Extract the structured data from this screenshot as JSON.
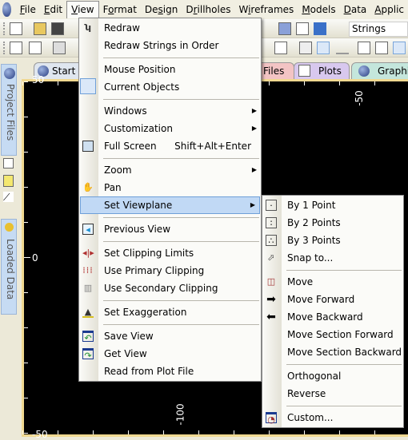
{
  "menubar": {
    "items": [
      {
        "label": "File",
        "u": "F",
        "rest": "ile"
      },
      {
        "label": "Edit",
        "u": "E",
        "rest": "dit"
      },
      {
        "label": "View",
        "u": "V",
        "rest": "iew"
      },
      {
        "label": "Format",
        "pre": "F",
        "u": "o",
        "rest": "rmat"
      },
      {
        "label": "Design",
        "pre": "De",
        "u": "s",
        "rest": "ign"
      },
      {
        "label": "Drillholes",
        "pre": "D",
        "u": "r",
        "rest": "illholes"
      },
      {
        "label": "Wireframes",
        "pre": "W",
        "u": "i",
        "rest": "reframes"
      },
      {
        "label": "Models",
        "u": "M",
        "rest": "odels"
      },
      {
        "label": "Data",
        "u": "D",
        "rest": "ata"
      },
      {
        "label": "Applic",
        "u": "A",
        "rest": "pplic"
      }
    ]
  },
  "toolbar": {
    "dropdown_value": "Strings"
  },
  "tabs": [
    {
      "label": "Start"
    },
    {
      "label": "Files",
      "color": "#f3c4c4"
    },
    {
      "label": "Plots",
      "color": "#d8c8ee"
    },
    {
      "label": "Graphics",
      "color": "#c4e6dc"
    }
  ],
  "sidebar": {
    "project_files": "Project Files",
    "loaded_data": "Loaded Data"
  },
  "viewport": {
    "top_label": "-50",
    "bottom_label": "-100",
    "left_labels": [
      "50",
      "0",
      "-50"
    ]
  },
  "view_menu": {
    "items": [
      {
        "label": "Redraw",
        "icon": "redraw-icon"
      },
      {
        "label": "Redraw Strings in Order"
      },
      {
        "sep": true
      },
      {
        "label": "Mouse Position"
      },
      {
        "label": "Current Objects",
        "icon": "current-objects-icon"
      },
      {
        "sep": true
      },
      {
        "label": "Windows",
        "submenu": true
      },
      {
        "label": "Customization",
        "submenu": true
      },
      {
        "label": "Full Screen",
        "shortcut": "Shift+Alt+Enter",
        "icon": "full-screen-icon"
      },
      {
        "sep": true
      },
      {
        "label": "Zoom",
        "submenu": true
      },
      {
        "label": "Pan",
        "icon": "hand-icon"
      },
      {
        "label": "Set Viewplane",
        "submenu": true,
        "highlighted": true
      },
      {
        "sep": true
      },
      {
        "label": "Previous View",
        "icon": "previous-view-icon"
      },
      {
        "sep": true
      },
      {
        "label": "Set Clipping Limits",
        "icon": "clipping-limits-icon"
      },
      {
        "label": "Use Primary Clipping",
        "icon": "primary-clipping-icon"
      },
      {
        "label": "Use Secondary Clipping",
        "icon": "secondary-clipping-icon"
      },
      {
        "sep": true
      },
      {
        "label": "Set Exaggeration",
        "icon": "exaggeration-icon"
      },
      {
        "sep": true
      },
      {
        "label": "Save View",
        "icon": "save-view-icon"
      },
      {
        "label": "Get View",
        "icon": "get-view-icon"
      },
      {
        "label": "Read from Plot File"
      }
    ]
  },
  "viewplane_submenu": {
    "items": [
      {
        "label": "By 1 Point",
        "icon": "by-1-point-icon"
      },
      {
        "label": "By 2 Points",
        "icon": "by-2-points-icon"
      },
      {
        "label": "By 3 Points",
        "icon": "by-3-points-icon"
      },
      {
        "label": "Snap to...",
        "icon": "snap-icon"
      },
      {
        "sep": true
      },
      {
        "label": "Move",
        "icon": "move-icon"
      },
      {
        "label": "Move Forward",
        "icon": "arrow-right-icon"
      },
      {
        "label": "Move Backward",
        "icon": "arrow-left-icon"
      },
      {
        "label": "Move Section Forward"
      },
      {
        "label": "Move Section Backward"
      },
      {
        "sep": true
      },
      {
        "label": "Orthogonal"
      },
      {
        "label": "Reverse"
      },
      {
        "sep": true
      },
      {
        "label": "Custom...",
        "icon": "custom-icon"
      }
    ]
  },
  "colors": {
    "highlight": "#c1d9f5",
    "viewport": "#000000",
    "viewport_border": "#f0d890"
  }
}
